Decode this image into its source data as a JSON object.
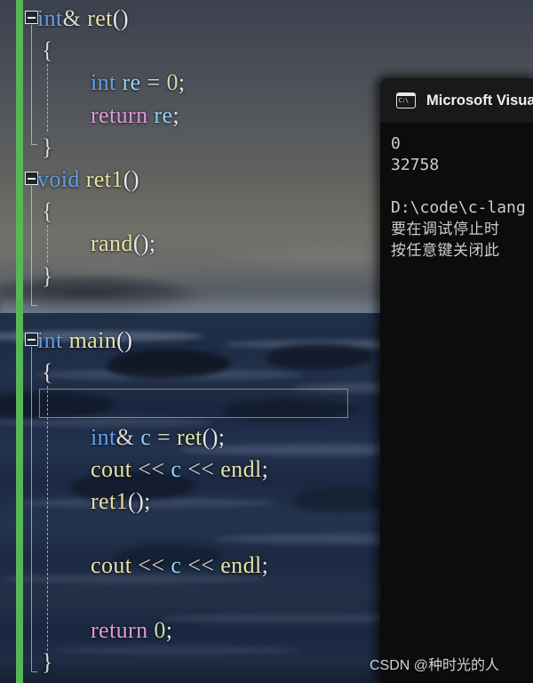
{
  "editor": {
    "gutter": {
      "change_indicator_color": "#57b756",
      "fold_icon": "collapse-minus-icon"
    },
    "theme": {
      "keyword_color": "#62a0e8",
      "return_color": "#e29ad8",
      "function_color": "#e7e2a4",
      "identifier_color": "#8fd3f7",
      "number_color": "#c8dba6",
      "punctuation_color": "#e6e8ea"
    },
    "lines": [
      {
        "n": 1,
        "indent": 0,
        "tokens": [
          {
            "t": "int",
            "c": "kw"
          },
          {
            "t": "&",
            "c": "op"
          },
          {
            "t": " ",
            "c": "pun"
          },
          {
            "t": "ret",
            "c": "fn"
          },
          {
            "t": "()",
            "c": "pun"
          }
        ]
      },
      {
        "n": 2,
        "indent": 0,
        "tokens": [
          {
            "t": "{",
            "c": "brc"
          }
        ]
      },
      {
        "n": 3,
        "indent": 1,
        "tokens": [
          {
            "t": "int",
            "c": "kw"
          },
          {
            "t": " ",
            "c": "pun"
          },
          {
            "t": "re",
            "c": "var"
          },
          {
            "t": " ",
            "c": "pun"
          },
          {
            "t": "=",
            "c": "op"
          },
          {
            "t": " ",
            "c": "pun"
          },
          {
            "t": "0",
            "c": "num"
          },
          {
            "t": ";",
            "c": "pun"
          }
        ]
      },
      {
        "n": 4,
        "indent": 1,
        "tokens": [
          {
            "t": "return",
            "c": "ret"
          },
          {
            "t": " ",
            "c": "pun"
          },
          {
            "t": "re",
            "c": "var"
          },
          {
            "t": ";",
            "c": "pun"
          }
        ]
      },
      {
        "n": 5,
        "indent": 0,
        "tokens": [
          {
            "t": "}",
            "c": "brc"
          }
        ]
      },
      {
        "n": 6,
        "indent": 0,
        "tokens": [
          {
            "t": "void",
            "c": "kw"
          },
          {
            "t": " ",
            "c": "pun"
          },
          {
            "t": "ret1",
            "c": "fn"
          },
          {
            "t": "()",
            "c": "pun"
          }
        ]
      },
      {
        "n": 7,
        "indent": 0,
        "tokens": [
          {
            "t": "{",
            "c": "brc"
          }
        ]
      },
      {
        "n": 8,
        "indent": 1,
        "tokens": [
          {
            "t": "rand",
            "c": "fn"
          },
          {
            "t": "();",
            "c": "pun"
          }
        ]
      },
      {
        "n": 9,
        "indent": 0,
        "tokens": [
          {
            "t": "}",
            "c": "brc"
          }
        ]
      },
      {
        "n": 10,
        "indent": 0,
        "tokens": []
      },
      {
        "n": 11,
        "indent": 0,
        "tokens": [
          {
            "t": "int",
            "c": "kw"
          },
          {
            "t": " ",
            "c": "pun"
          },
          {
            "t": "main",
            "c": "fn"
          },
          {
            "t": "()",
            "c": "pun"
          }
        ]
      },
      {
        "n": 12,
        "indent": 0,
        "tokens": [
          {
            "t": "{",
            "c": "brc"
          }
        ]
      },
      {
        "n": 13,
        "indent": 1,
        "tokens": []
      },
      {
        "n": 14,
        "indent": 1,
        "tokens": [
          {
            "t": "int",
            "c": "kw"
          },
          {
            "t": "&",
            "c": "op"
          },
          {
            "t": " ",
            "c": "pun"
          },
          {
            "t": "c",
            "c": "var"
          },
          {
            "t": " ",
            "c": "pun"
          },
          {
            "t": "=",
            "c": "op"
          },
          {
            "t": " ",
            "c": "pun"
          },
          {
            "t": "ret",
            "c": "fn"
          },
          {
            "t": "();",
            "c": "pun"
          }
        ]
      },
      {
        "n": 15,
        "indent": 1,
        "tokens": [
          {
            "t": "cout",
            "c": "fn"
          },
          {
            "t": " ",
            "c": "pun"
          },
          {
            "t": "<<",
            "c": "op"
          },
          {
            "t": " ",
            "c": "pun"
          },
          {
            "t": "c",
            "c": "var"
          },
          {
            "t": " ",
            "c": "pun"
          },
          {
            "t": "<<",
            "c": "op"
          },
          {
            "t": " ",
            "c": "pun"
          },
          {
            "t": "endl",
            "c": "fn"
          },
          {
            "t": ";",
            "c": "pun"
          }
        ]
      },
      {
        "n": 16,
        "indent": 1,
        "tokens": [
          {
            "t": "ret1",
            "c": "fn"
          },
          {
            "t": "();",
            "c": "pun"
          }
        ]
      },
      {
        "n": 17,
        "indent": 1,
        "tokens": []
      },
      {
        "n": 18,
        "indent": 1,
        "tokens": [
          {
            "t": "cout",
            "c": "fn"
          },
          {
            "t": " ",
            "c": "pun"
          },
          {
            "t": "<<",
            "c": "op"
          },
          {
            "t": " ",
            "c": "pun"
          },
          {
            "t": "c",
            "c": "var"
          },
          {
            "t": " ",
            "c": "pun"
          },
          {
            "t": "<<",
            "c": "op"
          },
          {
            "t": " ",
            "c": "pun"
          },
          {
            "t": "endl",
            "c": "fn"
          },
          {
            "t": ";",
            "c": "pun"
          }
        ]
      },
      {
        "n": 19,
        "indent": 1,
        "tokens": []
      },
      {
        "n": 20,
        "indent": 1,
        "tokens": [
          {
            "t": "return",
            "c": "ret"
          },
          {
            "t": " ",
            "c": "pun"
          },
          {
            "t": "0",
            "c": "num"
          },
          {
            "t": ";",
            "c": "pun"
          }
        ]
      },
      {
        "n": 21,
        "indent": 0,
        "tokens": [
          {
            "t": "}",
            "c": "brc"
          }
        ]
      }
    ]
  },
  "console": {
    "icon": "cmd-console-icon",
    "icon_text": "C:\\",
    "title": "Microsoft Visual",
    "output": [
      "0",
      "32758",
      "",
      "D:\\code\\c-lang",
      "要在调试停止时",
      "按任意键关闭此"
    ]
  },
  "watermark": {
    "text": "CSDN @种时光的人"
  }
}
